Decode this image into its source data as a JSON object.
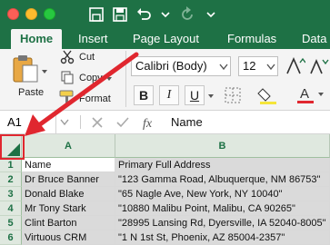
{
  "tabs": [
    {
      "label": "Home",
      "active": true
    },
    {
      "label": "Insert"
    },
    {
      "label": "Page Layout"
    },
    {
      "label": "Formulas"
    },
    {
      "label": "Data"
    }
  ],
  "clipboard": {
    "paste_label": "Paste",
    "cut_label": "Cut",
    "copy_label": "Copy",
    "format_label": "Format"
  },
  "font": {
    "name": "Calibri (Body)",
    "size": "12"
  },
  "format_buttons": [
    "B",
    "I",
    "U"
  ],
  "formula_bar": {
    "name_box": "A1",
    "content": "Name"
  },
  "sheet": {
    "columns": [
      "A",
      "B"
    ],
    "rows": [
      {
        "num": "1",
        "a": "Name",
        "b": "Primary Full Address"
      },
      {
        "num": "2",
        "a": "Dr Bruce Banner",
        "b": "\"123 Gamma Road, Albuquerque, NM 86753\""
      },
      {
        "num": "3",
        "a": "Donald Blake",
        "b": "\"65 Nagle Ave, New York, NY 10040\""
      },
      {
        "num": "4",
        "a": "Mr Tony Stark",
        "b": "\"10880 Malibu Point, Malibu, CA 90265\""
      },
      {
        "num": "5",
        "a": "Clint Barton",
        "b": "\"28995 Lansing Rd, Dyersville, IA 52040-8005\""
      },
      {
        "num": "6",
        "a": "Virtuous CRM",
        "b": "\"1 N 1st St, Phoenix, AZ 85004-2357\""
      }
    ]
  },
  "colors": {
    "brand": "#1e7145",
    "selected_cell": "#dadada",
    "annotation": "#e0272f"
  }
}
